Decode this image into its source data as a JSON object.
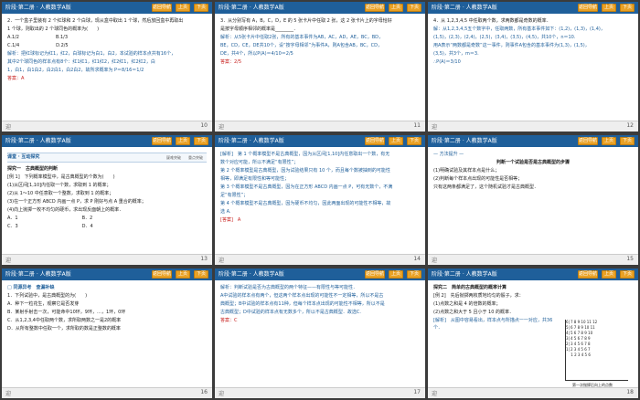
{
  "common": {
    "header_title": "阶段·第二册 · 人教数学A版",
    "btn_nav": "返回导航",
    "btn_up": "上页",
    "btn_down": "下页",
    "footer_left": "迎"
  },
  "slides": [
    {
      "page": "10",
      "lines": [
        "2．一个盒子里装有 2 个红球和 2 个白球，现从盒中取出 1 个球，然后放回盒中再取出",
        "1 个球，则取出的 2 个球同色的概率为(　　)",
        "A.1/2　　　　　　　　B.1/3",
        "C.1/4　　　　　　　　D.2/5",
        "解析：把红球标记为红1，红2，白球标记为白1，白2，本试验的样本点共有16个，",
        "其中2个球同色的样本点有8个：红1红1，红1红2，红2红1，红2红2，白",
        "1，白1，白1白2，白2白1，白2白2，故所求概率为 P＝8/16＝1/2",
        "答案：A"
      ]
    },
    {
      "page": "11",
      "lines": [
        "3．从分别写有 A，B，C，D，E 的 5 张卡片中任取 2 张，这 2 张卡片上的字母恰好",
        "是按字母顺序相邻的概率是________．",
        "解析：从5张卡片中任取2张，所有的基本事件为AB，AC，AD，AE，BC，BD，",
        "BE，CD，CE，DE共10个，设“按字母相邻”为事件A，则A包含AB，BC，CD，",
        "DE，共4个，所以P(A)＝4/10＝2/5",
        "答案：2/5"
      ]
    },
    {
      "page": "12",
      "lines": [
        "4．从 1,2,3,4,5 中任取两个数，求两数都是奇数的概率．",
        "解：从1,2,3,4,5五个数字中，任取两数，所有基本事件如下：(1,2)，(1,3)，(1,4)，",
        "(1,5)，(2,3)，(2,4)，(2,5)，(3,4)，(3,5)，(4,5)，共10个，n＝10.",
        "用A表示“两数都是奇数”这一事件，则事件A包含的基本事件为(1,3)，(1,5)，",
        "(3,5)，共3个，m＝3.",
        "∴P(A)＝3/10"
      ]
    },
    {
      "page": "13",
      "section": "课堂 · 互动探究",
      "section_note": "疑难突破　　重点突破",
      "lines": [
        "探究一　古典概型的判断",
        "[例 1]　下列概率模型中，是古典概型的个数为(　　)",
        "(1)从区间[1,10]内任取一个数，求取到 1 的概率；",
        "(2)从 1～10 中任意取一个整数，求取到 1 的概率；",
        "(3)在一个正方形 ABCD 内画一点 P，求 P 刚好与点 A 重合的概率；",
        "(4)向上抛掷一枚不均匀的硬币，求出现反面朝上的概率．",
        "A．1　　　　　　　　　　　　　　B．2",
        "C．3　　　　　　　　　　　　　　D．4"
      ]
    },
    {
      "page": "14",
      "lines": [
        "[解析]　第 1 个概率模型不是古典概型，因为从区间[1,10]内任意取出一个数，有无",
        "数个对应可能，所以不满足“有限性”；",
        "第 2 个概率模型是古典概型，因为试验结果只有 10 个，而且每个数被抽到的可能性",
        "相等，即满足有限性和等可能性；",
        "第 3 个概率模型不是古典概型，因为在正方形 ABCD 内画一点 P，可有无数个，不满",
        "足“有限性”；",
        "第 4 个概率模型不是古典概型，因为硬币不均匀，因此两面出现的可能性不相等，故",
        "选 A.",
        "[答案]　A"
      ]
    },
    {
      "page": "15",
      "lines": [
        "— 方法提升 —",
        "判断一个试验是否是古典概型的步骤",
        "(1)明确试验及其样本点是什么；",
        "(2)判断每个样本点出现的可能性是否相等；",
        "只有这两条都满足了，这个随机试验才是古典概型．"
      ]
    },
    {
      "page": "16",
      "lines": [
        "□ 同源异考　查漏补缺",
        "1．下列试验中，是古典概型的为(　　)",
        "A．种下一粒花生，观察它是否发芽",
        "B．某射手射击一次，可能命中10环，9环，…，1环，0环",
        "C．从1,2,3,4中任取两个数，求所取两数之一是2的概率",
        "D．从所有整数中任取一个，求所取的数是正整数的概率"
      ]
    },
    {
      "page": "17",
      "lines": [
        "解析：判断试验是否为古典概型的两个特征——有限性与等可能性．",
        "A中试验的样本点有两个，但这两个样本点出现的可能性不一定相等，所以不是古",
        "典概型；B中试验的样本点有11种，但每个样本点出现的可能性不相等，所以不是",
        "古典概型；D中试验的样本点有无数多个，所以不是古典概型．故选C.",
        "答案：C"
      ]
    },
    {
      "page": "18",
      "lines": [
        "探究二　简单的古典概型的概率计算",
        "[例 2]　先后抛掷两枚质地均匀的骰子，求：",
        "(1)点数之和是 4 的倍数的概率；",
        "(2)点数之和大于 5 且小于 10 的概率．",
        "[解析]　从图中容易看出，样本点与所描点一一对应，共36个．"
      ],
      "grid_rows": [
        "6│7 8 9 10 11 12",
        "5│6 7 8 9 10 11",
        "4│5 6 7 8 9 10",
        "3│4 5 6 7 8 9",
        "2│3 4 5 6 7 8",
        "1│2 3 4 5 6 7",
        "　 1 2 3 4 5 6"
      ],
      "grid_caption": "第一次抛掷后向上的点数"
    }
  ]
}
